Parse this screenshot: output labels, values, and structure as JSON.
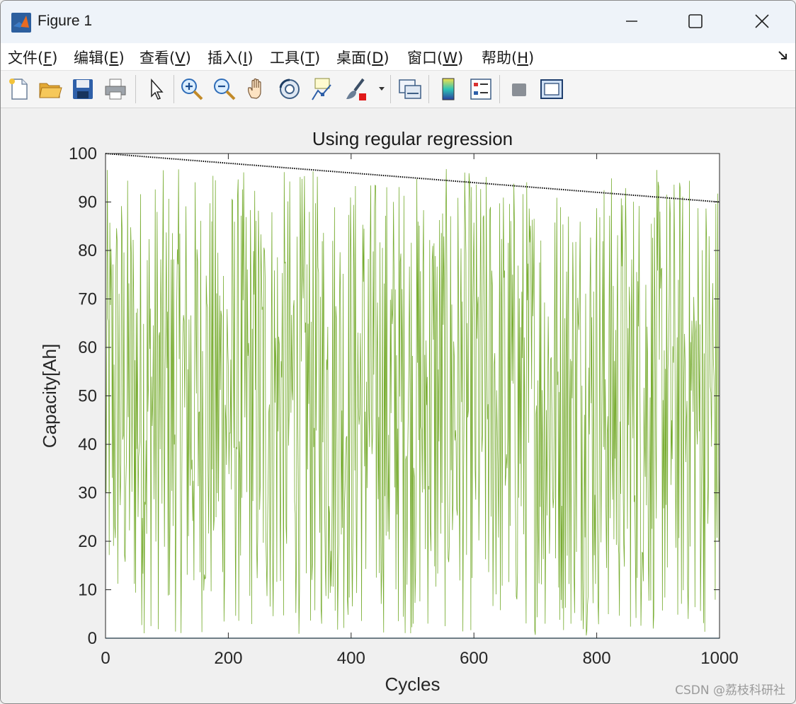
{
  "window": {
    "title": "Figure 1"
  },
  "menu": [
    {
      "label": "文件(",
      "key": "F",
      "close": ")"
    },
    {
      "label": "编辑(",
      "key": "E",
      "close": ")"
    },
    {
      "label": "查看(",
      "key": "V",
      "close": ")"
    },
    {
      "label": "插入(",
      "key": "I",
      "close": ")"
    },
    {
      "label": "工具(",
      "key": "T",
      "close": ")"
    },
    {
      "label": "桌面(",
      "key": "D",
      "close": ")"
    },
    {
      "label": "窗口(",
      "key": "W",
      "close": ")"
    },
    {
      "label": "帮助(",
      "key": "H",
      "close": ")"
    }
  ],
  "toolbar": [
    "new-figure-icon",
    "open-file-icon",
    "save-icon",
    "print-icon",
    "edit-plot-arrow-icon",
    "zoom-in-icon",
    "zoom-out-icon",
    "pan-hand-icon",
    "rotate-3d-icon",
    "data-cursor-icon",
    "brush-icon",
    "link-plot-icon",
    "colorbar-icon",
    "legend-icon",
    "hide-plot-tools-icon",
    "show-plot-tools-icon"
  ],
  "chart_data": {
    "type": "line",
    "title": "Using regular regression",
    "xlabel": "Cycles",
    "ylabel": "Capacity[Ah]",
    "xlim": [
      0,
      1000
    ],
    "ylim": [
      0,
      100
    ],
    "xticks": [
      "0",
      "200",
      "400",
      "600",
      "800",
      "1000"
    ],
    "yticks": [
      "0",
      "10",
      "20",
      "30",
      "40",
      "50",
      "60",
      "70",
      "80",
      "90",
      "100"
    ],
    "grid": false,
    "series": [
      {
        "style": "dotted",
        "color": "#000000",
        "x": [
          0,
          1000
        ],
        "y": [
          100,
          90
        ]
      },
      {
        "style": "solid",
        "color": "#77ac30",
        "x_range": [
          0,
          1000
        ],
        "points": 1000,
        "y_range": [
          0.5,
          97
        ]
      },
      {
        "style": "solid",
        "color": "#0072bd",
        "x": [
          0,
          1000
        ],
        "y": [
          0,
          0
        ]
      }
    ]
  },
  "watermark": "CSDN @荔枝科研社"
}
